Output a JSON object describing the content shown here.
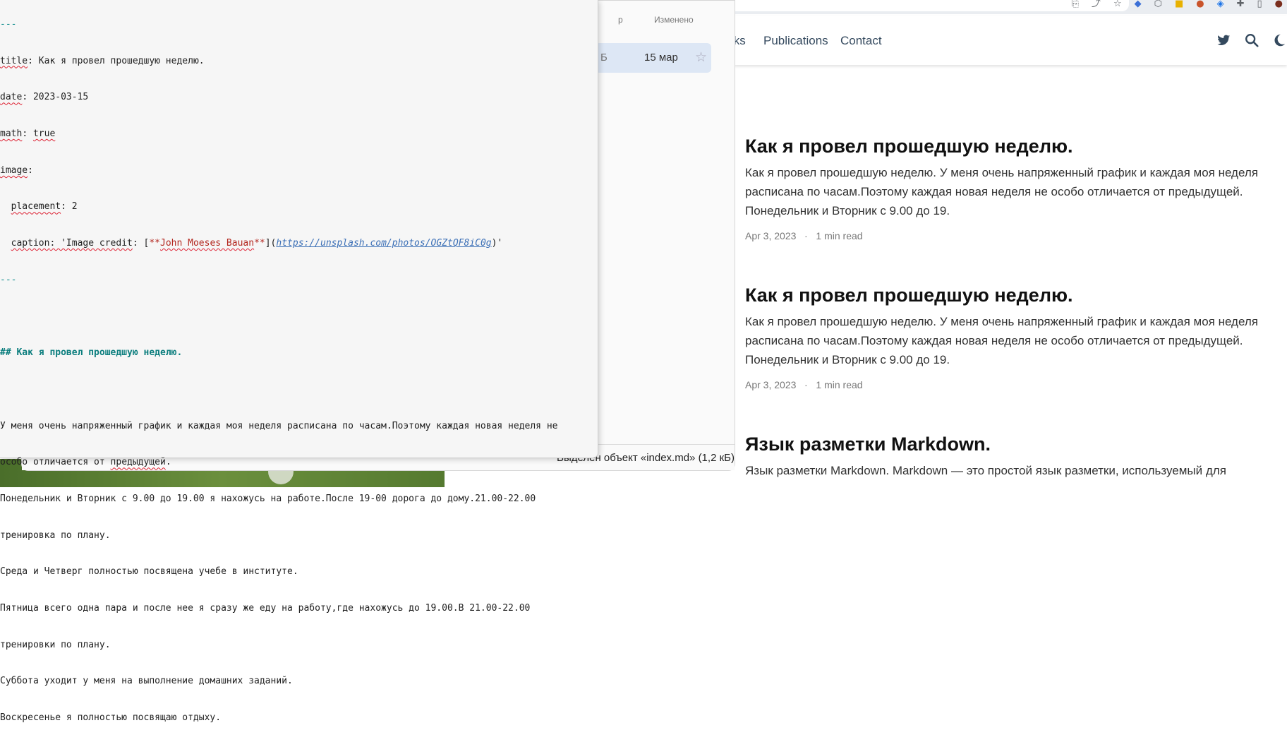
{
  "browser": {
    "nav": {
      "links": [
        "lks",
        "Publications",
        "Contact"
      ]
    },
    "posts": [
      {
        "title": "Как я провел прошедшую неделю.",
        "summary": "Как я провел прошедшую неделю. У меня очень напряженный график и каждая моя неделя расписана по часам.Поэтому каждая новая неделя не особо отличается от предыдущей. Понедельник и Вторник с 9.00 до 19.",
        "date": "Apr 3, 2023",
        "read": "1 min read"
      },
      {
        "title": "Как я провел прошедшую неделю.",
        "summary": "Как я провел прошедшую неделю. У меня очень напряженный график и каждая моя неделя расписана по часам.Поэтому каждая новая неделя не особо отличается от предыдущей. Понедельник и Вторник с 9.00 до 19.",
        "date": "Apr 3, 2023",
        "read": "1 min read"
      },
      {
        "title": "Язык разметки Markdown.",
        "summary": "Язык разметки Markdown. Markdown — это простой язык разметки, используемый для"
      }
    ],
    "icons": [
      "twitter-icon",
      "search-icon",
      "moon-icon"
    ]
  },
  "filemanager": {
    "col_partial": "р",
    "col_modified": "Изменено",
    "row_size_partial": "Б",
    "row_date": "15 мар",
    "status": "Выделен объект «index.md»  (1,2 кБ)"
  },
  "editor": {
    "sep": "---",
    "title_key": "title",
    "title_val": ": Как я провел прошедшую неделю.",
    "date_key": "date",
    "date_val": ": 2023-03-15",
    "math_key": "math",
    "math_val": "true",
    "image_key": "image",
    "placement_key": "placement",
    "placement_val": ": 2",
    "caption_key": "caption",
    "caption_q": ": 'Image ",
    "caption_credit": "credit",
    "caption_bracket": ": [",
    "caption_stars": "**",
    "caption_name": "John Moeses Bauan",
    "caption_mid": "](",
    "caption_url": "https://unsplash.com/photos/OGZtQF8iC0g",
    "caption_end": ")'",
    "heading": "## Как я провел прошедшую неделю.",
    "body_lines": [
      "У меня очень напряженный график и каждая моя неделя расписана по часам.Поэтому каждая новая неделя не",
      "особо отличается от ",
      "Понедельник и Вторник с 9.00 до 19.00 я нахожусь на работе.После 19-00 дорога до дому.21.00-22.00",
      "тренировка по плану.",
      "Среда и Четверг полностью посвящена учебе в институте.",
      "Пятница всего одна пара и после нее я сразу же еду на работу,где нахожусь до 19.00.В 21.00-22.00",
      "тренировки по плану.",
      "Суббота уходит у меня на выполнение домашних заданий.",
      "Воскресенье я полностью посвящаю отдыху."
    ],
    "prev_word": "предыдущей",
    "prev_dot": "."
  }
}
